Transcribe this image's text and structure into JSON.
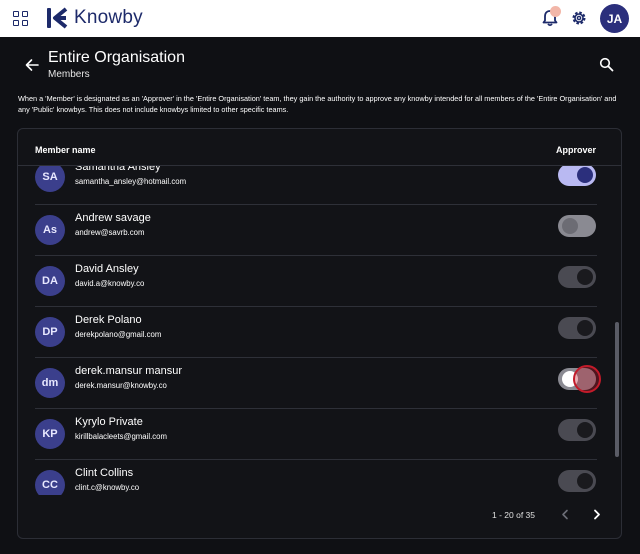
{
  "app": {
    "brand_name": "Knowby",
    "user_initials": "JA",
    "brand_color": "#1d2a6a",
    "accent_color": "#2b2f7c"
  },
  "header": {
    "title": "Entire Organisation",
    "subtitle": "Members",
    "description": "When a 'Member' is designated as an 'Approver' in the 'Entire Organisation' team, they gain the authority to approve any knowby intended for all members of the 'Entire Organisation' and any 'Public' knowbys. This does not include knowbys limited to other specific teams."
  },
  "table": {
    "col_name": "Member name",
    "col_approver": "Approver",
    "members": [
      {
        "initials": "SA",
        "name": "Samantha Ansley",
        "email": "samantha_ansley@hotmail.com",
        "approver": true
      },
      {
        "initials": "As",
        "name": "Andrew savage",
        "email": "andrew@savrb.com",
        "approver": false
      },
      {
        "initials": "DA",
        "name": "David Ansley",
        "email": "david.a@knowby.co",
        "approver": false
      },
      {
        "initials": "DP",
        "name": "Derek Polano",
        "email": "derekpolano@gmail.com",
        "approver": false
      },
      {
        "initials": "dm",
        "name": "derek.mansur mansur",
        "email": "derek.mansur@knowby.co",
        "approver": false
      },
      {
        "initials": "KP",
        "name": "Kyrylo Private",
        "email": "kirillbalacleets@gmail.com",
        "approver": false
      },
      {
        "initials": "CC",
        "name": "Clint Collins",
        "email": "clint.c@knowby.co",
        "approver": false
      }
    ]
  },
  "pagination": {
    "range_text": "1 - 20 of 35"
  },
  "icons": {
    "apps": "apps-grid-icon",
    "bell": "bell-icon",
    "settings": "gear-icon",
    "back": "arrow-left-icon",
    "search": "search-icon",
    "prev": "chevron-left-icon",
    "next": "chevron-right-icon"
  }
}
